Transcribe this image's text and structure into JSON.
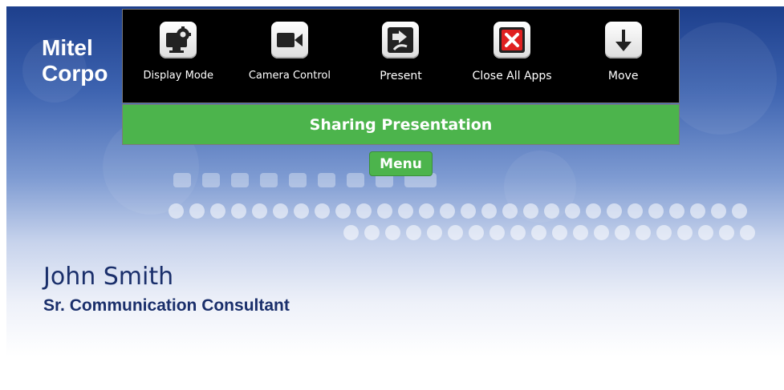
{
  "slide": {
    "company_line1": "Mitel",
    "company_line2": "Corpo",
    "person_name": "John Smith",
    "person_title": "Sr. Communication Consultant"
  },
  "toolbar": {
    "items": [
      {
        "label": "Display Mode",
        "icon": "display-mode-icon"
      },
      {
        "label": "Camera Control",
        "icon": "camera-icon"
      },
      {
        "label": "Present",
        "icon": "present-icon"
      },
      {
        "label": "Close All Apps",
        "icon": "close-all-icon"
      },
      {
        "label": "Move",
        "icon": "arrow-down-icon"
      }
    ]
  },
  "banner": {
    "text": "Sharing Presentation"
  },
  "menu": {
    "label": "Menu"
  },
  "colors": {
    "accent_green": "#4cb44c",
    "toolbar_bg": "#000000",
    "close_red": "#e02020",
    "slide_text": "#1a2f6b"
  }
}
